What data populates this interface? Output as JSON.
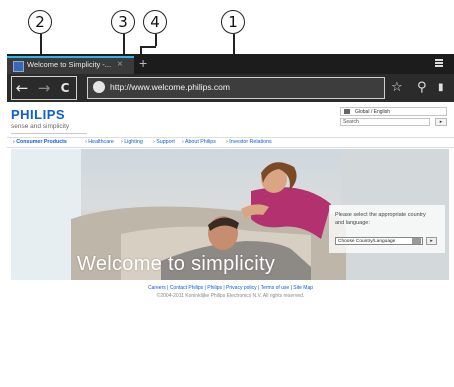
{
  "annotations": {
    "callouts": [
      "2",
      "3",
      "4",
      "1"
    ]
  },
  "browser": {
    "tab": {
      "title": "Welcome to Simplicity -...",
      "close_glyph": "×",
      "favicon": "philips-favicon"
    },
    "new_tab_glyph": "+",
    "overflow_menu": "overflow-menu-icon",
    "nav": {
      "back_glyph": "←",
      "forward_glyph": "→",
      "refresh_glyph": "C"
    },
    "url": "http://www.welcome.philips.com",
    "url_icon": "globe-icon",
    "bookmark_star_glyph": "☆",
    "search_glyph": "⚲",
    "bookmarks_glyph": "▮"
  },
  "page": {
    "logo": "PHILIPS",
    "tagline": "sense and simplicity",
    "region_selector": "Global / English",
    "search_placeholder": "Search",
    "search_go": "▸",
    "nav_items": [
      "› Consumer Products",
      "› Healthcare",
      "› Lighting",
      "› Support",
      "› About Philips",
      "› Investor Relations"
    ],
    "hero_title": "Welcome to simplicity",
    "country_prompt": "Please select the appropriate country and language:",
    "country_select_value": "Choose Country/Language",
    "country_go": "▸",
    "footer_links": "Careers  |  Contact Philips  |  Philips  |  Privacy policy  |  Terms of use  |  Site Map",
    "copyright": "©2004-2011 Koninklijke Philips Electronics N.V. All rights reserved."
  },
  "colors": {
    "brand_blue": "#0b5ed7",
    "chrome_dark": "#2b2b2b",
    "tab_accent": "#33b5e5"
  }
}
